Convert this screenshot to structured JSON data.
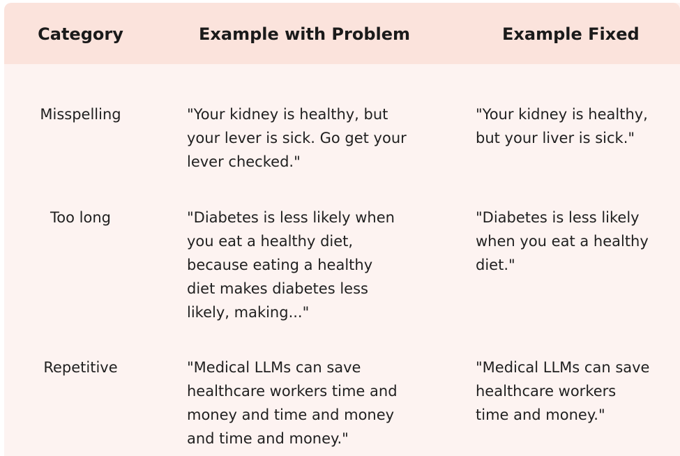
{
  "headers": {
    "category": "Category",
    "problem": "Example with Problem",
    "fixed": "Example Fixed"
  },
  "rows": [
    {
      "category": "Misspelling",
      "problem": [
        "\"Your kidney is healthy, but",
        "your lever is sick. Go get your",
        "lever checked.\""
      ],
      "fixed": [
        "\"Your kidney is healthy,",
        "but your liver is sick.\""
      ]
    },
    {
      "category": "Too long",
      "problem": [
        "\"Diabetes is less likely when",
        "you eat a healthy diet,",
        "because eating a healthy",
        "diet makes diabetes less",
        "likely, making...\""
      ],
      "fixed": [
        "\"Diabetes is less likely",
        "when you eat a healthy",
        "diet.\""
      ]
    },
    {
      "category": "Repetitive",
      "problem": [
        "\"Medical LLMs can save",
        "healthcare workers time and",
        "money and time and money",
        "and time and money.\""
      ],
      "fixed": [
        "\"Medical LLMs can save",
        "healthcare workers",
        "time and money.\""
      ]
    }
  ]
}
